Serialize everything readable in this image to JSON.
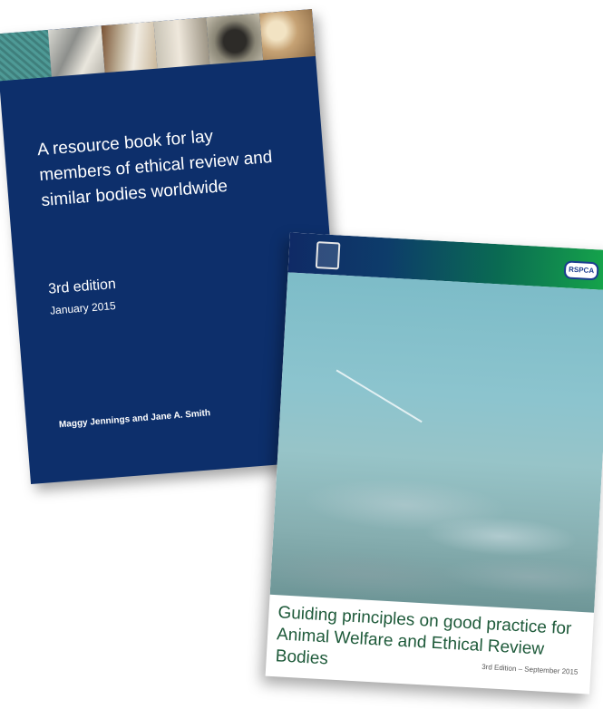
{
  "book1": {
    "title": "A resource book for lay members of ethical review and similar bodies worldwide",
    "edition": "3rd edition",
    "date": "January 2015",
    "authors": "Maggy Jennings and Jane A. Smith",
    "background_color": "#0d2f6b"
  },
  "book2": {
    "logo_right": "RSPCA",
    "title": "Guiding principles on good practice for Animal Welfare and Ethical Review Bodies",
    "edition": "3rd Edition – September 2015",
    "title_color": "#1e5a3a"
  }
}
